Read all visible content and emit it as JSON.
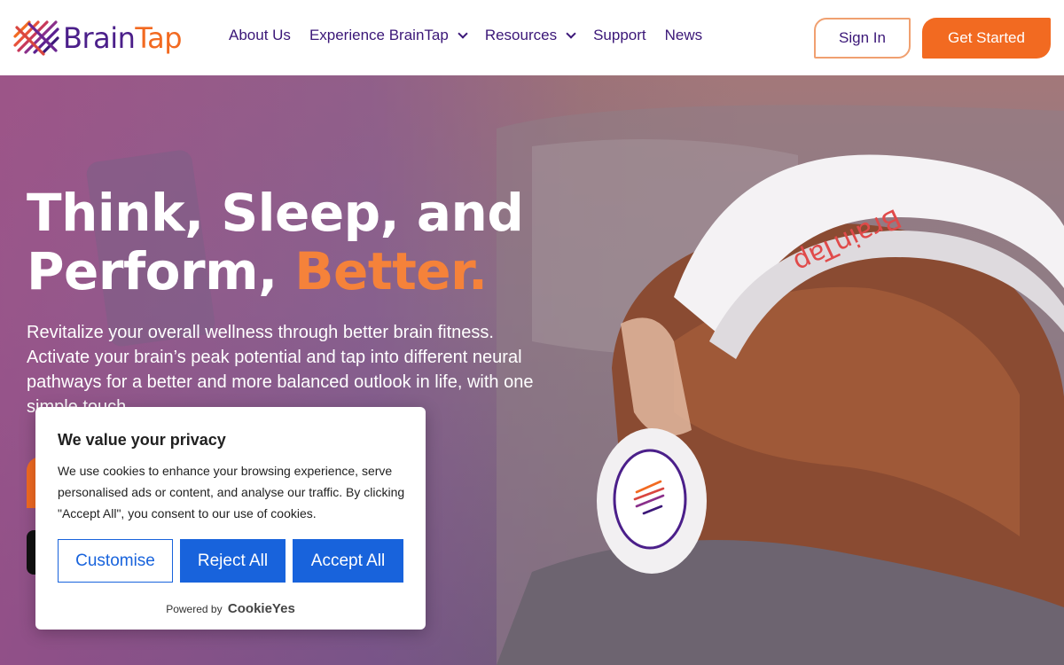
{
  "header": {
    "logo": {
      "brain": "Brain",
      "tap": "Tap"
    },
    "nav": [
      {
        "label": "About Us",
        "dropdown": false
      },
      {
        "label": "Experience BrainTap",
        "dropdown": true
      },
      {
        "label": "Resources",
        "dropdown": true
      },
      {
        "label": "Support",
        "dropdown": false
      },
      {
        "label": "News",
        "dropdown": false
      }
    ],
    "sign_in": "Sign In",
    "get_started": "Get Started"
  },
  "hero": {
    "title_line1": "Think, Sleep, and",
    "title_line2_prefix": "Perform, ",
    "title_line2_accent": "Better.",
    "subtitle": "Revitalize your overall wellness through better brain fitness. Activate your brain’s peak potential and tap into different neural pathways for a better and more balanced outlook in life, with one simple touch.",
    "headset_brand": "BrainTap"
  },
  "cookie_banner": {
    "title": "We value your privacy",
    "text": "We use cookies to enhance your browsing experience, serve personalised ads or content, and analyse our traffic. By clicking \"Accept All\", you consent to our use of cookies.",
    "customise": "Customise",
    "reject_all": "Reject All",
    "accept_all": "Accept All",
    "powered_by": "Powered by",
    "powered_brand": "CookieYes"
  },
  "colors": {
    "brand_purple": "#3b1778",
    "brand_orange": "#f26a21",
    "cookie_blue": "#1863dc"
  }
}
